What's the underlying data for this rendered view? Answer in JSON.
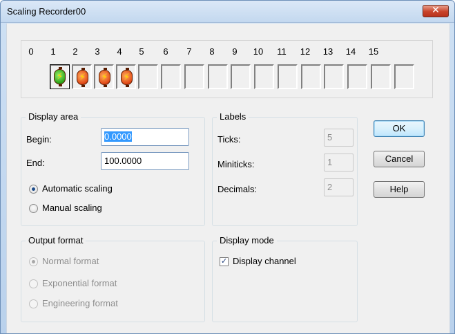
{
  "window": {
    "title": "Scaling Recorder00"
  },
  "channels": {
    "labels": [
      "0",
      "1",
      "2",
      "3",
      "4",
      "5",
      "6",
      "7",
      "8",
      "9",
      "10",
      "11",
      "12",
      "13",
      "14",
      "15"
    ],
    "states": [
      "active-green",
      "active-red",
      "active-red",
      "active-red",
      "empty",
      "empty",
      "empty",
      "empty",
      "empty",
      "empty",
      "empty",
      "empty",
      "empty",
      "empty",
      "empty",
      "empty"
    ]
  },
  "display_area": {
    "title": "Display area",
    "begin_label": "Begin:",
    "begin_value": "0.0000",
    "end_label": "End:",
    "end_value": "100.0000",
    "auto_label": "Automatic scaling",
    "manual_label": "Manual scaling",
    "selected": "auto"
  },
  "labels_group": {
    "title": "Labels",
    "ticks_label": "Ticks:",
    "ticks_value": "5",
    "miniticks_label": "Miniticks:",
    "miniticks_value": "1",
    "decimals_label": "Decimals:",
    "decimals_value": "2"
  },
  "output_format": {
    "title": "Output format",
    "normal_label": "Normal format",
    "exponential_label": "Exponential format",
    "engineering_label": "Engineering format",
    "selected": "normal"
  },
  "display_mode": {
    "title": "Display mode",
    "display_channel_label": "Display channel",
    "display_channel_checked": true
  },
  "buttons": {
    "ok": "OK",
    "cancel": "Cancel",
    "help": "Help"
  },
  "colors": {
    "accent": "#3399ff",
    "close_red": "#c8432a"
  }
}
